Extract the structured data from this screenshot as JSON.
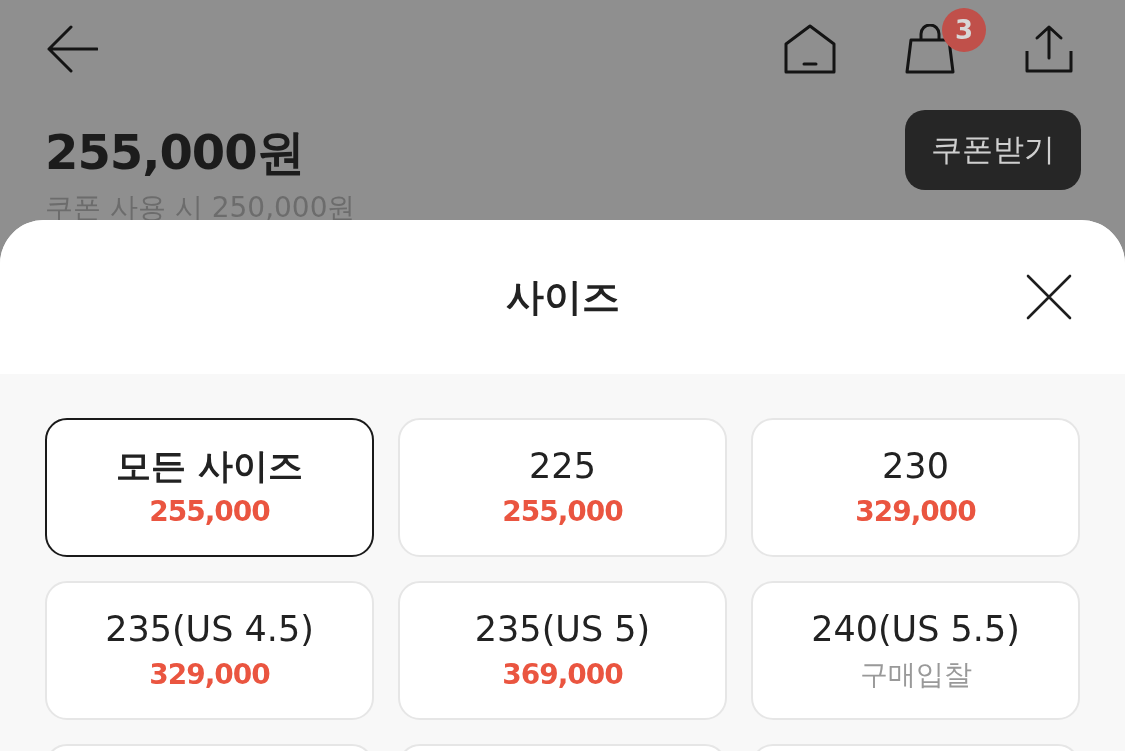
{
  "top_bar": {
    "cart_badge": "3"
  },
  "product": {
    "price": "255,000원",
    "coupon_button": "쿠폰받기",
    "coupon_price": "쿠폰 사용 시 250,000원"
  },
  "size_sheet": {
    "title": "사이즈",
    "options": [
      {
        "label": "모든 사이즈",
        "value": "255,000",
        "kind": "price",
        "selected": true
      },
      {
        "label": "225",
        "value": "255,000",
        "kind": "price",
        "selected": false
      },
      {
        "label": "230",
        "value": "329,000",
        "kind": "price",
        "selected": false
      },
      {
        "label": "235(US 4.5)",
        "value": "329,000",
        "kind": "price",
        "selected": false
      },
      {
        "label": "235(US 5)",
        "value": "369,000",
        "kind": "price",
        "selected": false
      },
      {
        "label": "240(US 5.5)",
        "value": "구매입찰",
        "kind": "bid",
        "selected": false
      }
    ],
    "more_below": true
  }
}
